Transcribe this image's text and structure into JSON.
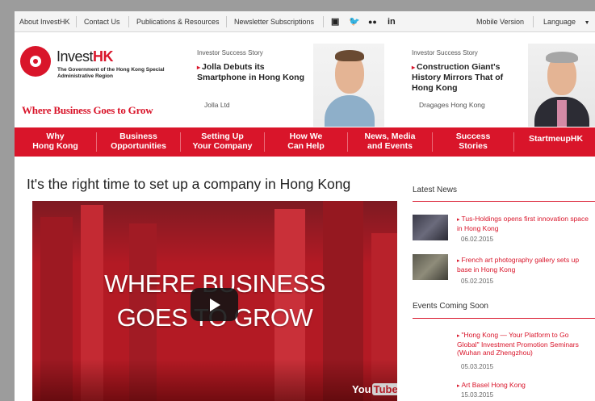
{
  "topbar": {
    "about": "About InvestHK",
    "contact": "Contact Us",
    "publications": "Publications & Resources",
    "newsletter": "Newsletter Subscriptions",
    "mobile": "Mobile Version",
    "language": "Language",
    "social_icons": [
      "youtube-icon",
      "twitter-icon",
      "flickr-icon",
      "linkedin-icon"
    ]
  },
  "header": {
    "logo_invest": "Invest",
    "logo_hk": "HK",
    "logo_sub": "The Government of the Hong Kong Special Administrative Region",
    "tagline": "Where Business Goes to Grow"
  },
  "stories": [
    {
      "eyebrow": "Investor Success Story",
      "title": "Jolla Debuts its Smartphone in Hong Kong",
      "company": "Jolla Ltd"
    },
    {
      "eyebrow": "Investor Success Story",
      "title": "Construction Giant's History Mirrors That of Hong Kong",
      "company": "Dragages Hong Kong"
    }
  ],
  "nav": [
    {
      "line1": "Why",
      "line2": "Hong Kong"
    },
    {
      "line1": "Business",
      "line2": "Opportunities"
    },
    {
      "line1": "Setting Up",
      "line2": "Your Company"
    },
    {
      "line1": "How We",
      "line2": "Can Help"
    },
    {
      "line1": "News, Media",
      "line2": "and Events"
    },
    {
      "line1": "Success",
      "line2": "Stories"
    },
    {
      "line1": "StartmeupHK",
      "line2": ""
    }
  ],
  "main": {
    "title": "It's the right time to set up a company in Hong Kong",
    "video_line1": "WHERE BUSINESS",
    "video_line2": "GOES TO GROW",
    "youtube_you": "You",
    "youtube_tube": "Tube"
  },
  "sidebar": {
    "latest_news_heading": "Latest News",
    "news": [
      {
        "title": "Tus-Holdings opens first innovation space in Hong Kong",
        "date": "06.02.2015"
      },
      {
        "title": "French art photography gallery sets up base in Hong Kong",
        "date": "05.02.2015"
      }
    ],
    "events_heading": "Events Coming Soon",
    "events": [
      {
        "title": "\"Hong Kong — Your Platform to Go Global\" Investment Promotion Seminars (Wuhan and Zhengzhou)",
        "date": "05.03.2015"
      },
      {
        "title": "Art Basel Hong Kong",
        "date": "15.03.2015"
      }
    ]
  },
  "colors": {
    "brand_red": "#d9152a",
    "background_gray": "#9c9c9c"
  }
}
